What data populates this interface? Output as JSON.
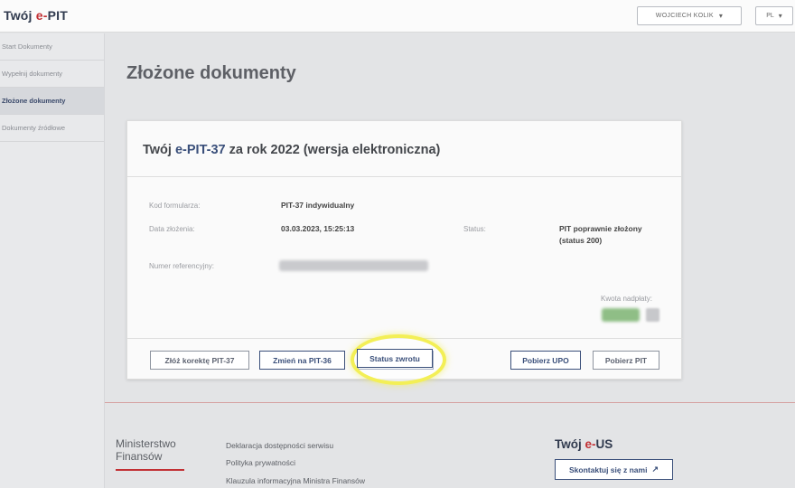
{
  "header": {
    "logo_prefix": "Twój ",
    "logo_e": "e-",
    "logo_suffix": "PIT",
    "user_name": "WOJCIECH KOLIK",
    "lang": "PL"
  },
  "sidebar": {
    "items": [
      {
        "label": "Start Dokumenty"
      },
      {
        "label": "Wypełnij dokumenty"
      },
      {
        "label": "Złożone dokumenty",
        "active": true
      },
      {
        "label": "Dokumenty źródłowe"
      }
    ]
  },
  "main": {
    "title": "Złożone dokumenty",
    "card": {
      "title_prefix": "Twój ",
      "title_hl": "e-PIT-37",
      "title_suffix": " za rok 2022 (wersja elektroniczna)",
      "form_code_label": "Kod formularza:",
      "form_code_value": "PIT-37 indywidualny",
      "submit_date_label": "Data złożenia:",
      "submit_date_value": "03.03.2023, 15:25:13",
      "status_label": "Status:",
      "status_value_line1": "PIT poprawnie złożony",
      "status_value_line2": "(status 200)",
      "reference_label": "Numer referencyjny:",
      "refund_label": "Kwota nadpłaty:",
      "buttons": {
        "correction": "Złóż korektę PIT-37",
        "change": "Zmień na PIT-36",
        "refund_status": "Status zwrotu",
        "download_upo": "Pobierz UPO",
        "download_pit": "Pobierz PIT"
      }
    }
  },
  "footer": {
    "ministry_line1": "Ministerstwo",
    "ministry_line2": "Finansów",
    "links": [
      "Deklaracja dostępności serwisu",
      "Polityka prywatności",
      "Klauzula informacyjna Ministra Finansów"
    ],
    "eus_prefix": "Twój ",
    "eus_e": "e-",
    "eus_suffix": "US",
    "contact_label": "Skontaktuj się z nami"
  },
  "colors": {
    "brand_navy": "#3a4f7a",
    "brand_red": "#c23034",
    "highlight": "#f3ef56"
  }
}
